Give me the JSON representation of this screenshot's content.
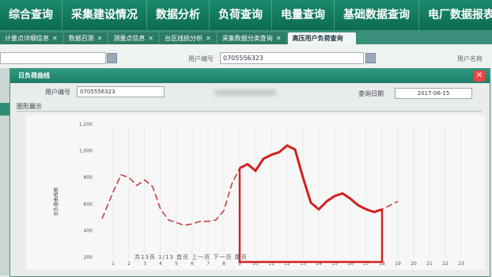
{
  "nav": {
    "items": [
      "综合查询",
      "采集建设情况",
      "数据分析",
      "负荷查询",
      "电量查询",
      "基础数据查询",
      "电厂数据报表"
    ]
  },
  "tabs": [
    {
      "label": "计量点详细信息",
      "active": false
    },
    {
      "label": "数据召测",
      "active": false
    },
    {
      "label": "测量点信息",
      "active": false
    },
    {
      "label": "台区线损分析",
      "active": false
    },
    {
      "label": "采集数据分类查询",
      "active": false
    },
    {
      "label": "高压用户负荷查询",
      "active": true
    }
  ],
  "background_form": {
    "user_number_label": "用户编号",
    "user_number_value": "0705556323",
    "user_name_label": "用户名称"
  },
  "modal": {
    "title": "日负荷曲线",
    "user_number_label": "用户编号",
    "user_number_value": "0705556323",
    "query_date_label": "查询日期",
    "query_date_value": "2017-06-15",
    "section_label": "图形展示"
  },
  "chart_data": {
    "type": "line",
    "ylabel": "日负荷曲线图",
    "yticks": [
      "1,200",
      "1,000",
      "800",
      "600",
      "400",
      "200"
    ],
    "ylim": [
      200,
      1200
    ],
    "x_ticks": [
      "1",
      "2",
      "3",
      "4",
      "5",
      "6",
      "7",
      "8",
      "9",
      "10",
      "11",
      "12",
      "13",
      "14",
      "15",
      "16",
      "17",
      "18",
      "19",
      "20",
      "21",
      "22",
      "23"
    ],
    "x": [
      0.3,
      1,
      1.5,
      2,
      2.5,
      3,
      3.5,
      4,
      4.5,
      5,
      5.5,
      6,
      6.5,
      7,
      7.5,
      8,
      8.5,
      9,
      9.5,
      10,
      10.5,
      11,
      11.5,
      12,
      12.5,
      13,
      13.5,
      14,
      14.5,
      15,
      15.5,
      16,
      16.5,
      17,
      17.5,
      18,
      18.5,
      19,
      19.5,
      20,
      20.5,
      21,
      21.5,
      22,
      22.5,
      23,
      23.5,
      24
    ],
    "values": [
      490,
      690,
      820,
      800,
      740,
      780,
      730,
      560,
      480,
      460,
      440,
      450,
      470,
      470,
      480,
      550,
      750,
      870,
      900,
      850,
      940,
      970,
      990,
      1040,
      1010,
      800,
      610,
      560,
      620,
      660,
      680,
      640,
      590,
      560,
      540,
      560,
      590,
      620
    ],
    "highlight_range": [
      9,
      18
    ],
    "highlight_color": "#d42020"
  },
  "footer": {
    "text": "共13页  1/13  首页 上一页 下一页 尾页"
  }
}
